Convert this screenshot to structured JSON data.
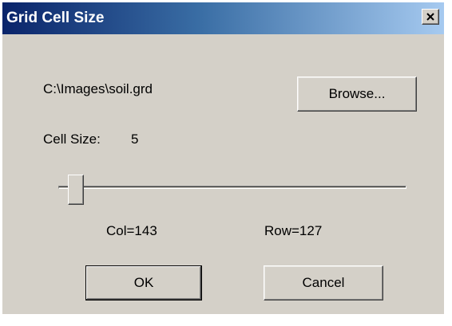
{
  "window": {
    "title": "Grid Cell Size",
    "close_icon": "close-icon"
  },
  "file": {
    "path": "C:\\Images\\soil.grd",
    "browse_label": "Browse..."
  },
  "cell_size": {
    "label": "Cell Size:",
    "value": "5"
  },
  "slider": {
    "value_fraction": 0.03
  },
  "grid": {
    "col_text": "Col=143",
    "row_text": "Row=127"
  },
  "buttons": {
    "ok_label": "OK",
    "cancel_label": "Cancel"
  },
  "colors": {
    "title_gradient_start": "#0a246a",
    "title_gradient_end": "#a6caf0",
    "face": "#d4d0c8"
  }
}
